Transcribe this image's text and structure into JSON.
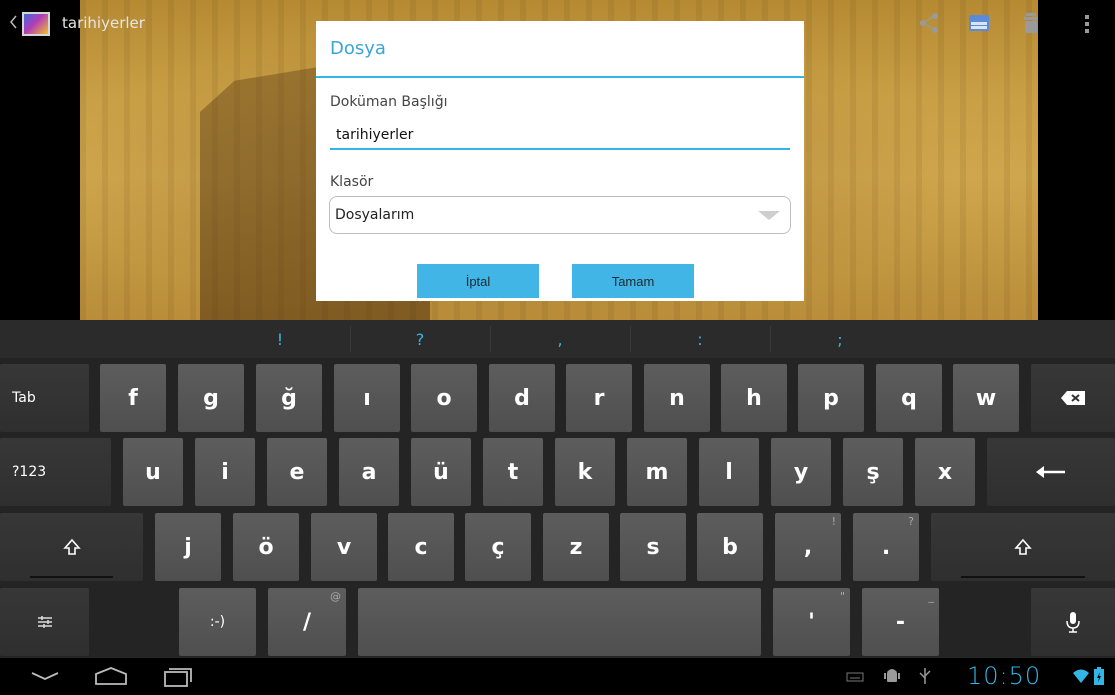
{
  "app": {
    "title": "tarihiyerler"
  },
  "dialog": {
    "title": "Dosya",
    "doc_title_label": "Doküman Başlığı",
    "doc_title_value": "tarihiyerler",
    "folder_label": "Klasör",
    "folder_value": "Dosyalarım",
    "cancel_label": "İptal",
    "ok_label": "Tamam"
  },
  "suggestions": [
    "!",
    "?",
    ",",
    ":",
    ";"
  ],
  "keyboard": {
    "row1": [
      "f",
      "g",
      "ğ",
      "ı",
      "o",
      "d",
      "r",
      "n",
      "h",
      "p",
      "q",
      "w"
    ],
    "row2": [
      "u",
      "i",
      "e",
      "a",
      "ü",
      "t",
      "k",
      "m",
      "l",
      "y",
      "ş",
      "x"
    ],
    "row3": [
      "j",
      "ö",
      "v",
      "c",
      "ç",
      "z",
      "s",
      "b"
    ],
    "tab_label": "Tab",
    "symbols_label": "?123",
    "smiley_label": ":-)",
    "slash_label": "/",
    "slash_hint": "@",
    "comma_label": ",",
    "comma_hint": "!",
    "period_label": ".",
    "period_hint": "?",
    "apostrophe_label": "'",
    "apostrophe_hint": "\"",
    "dash_label": "-",
    "dash_hint": "_"
  },
  "status": {
    "time": "10:50"
  },
  "colors": {
    "accent": "#33b5e5",
    "button": "#41b6e6"
  },
  "icons": {
    "back": "back-chevron-icon",
    "share": "share-icon",
    "folder": "folder-icon",
    "delete": "trash-icon",
    "overflow": "overflow-menu-icon",
    "backspace": "backspace-icon",
    "enter": "enter-icon",
    "shift": "shift-icon",
    "settings": "keyboard-settings-icon",
    "mic": "microphone-icon"
  }
}
